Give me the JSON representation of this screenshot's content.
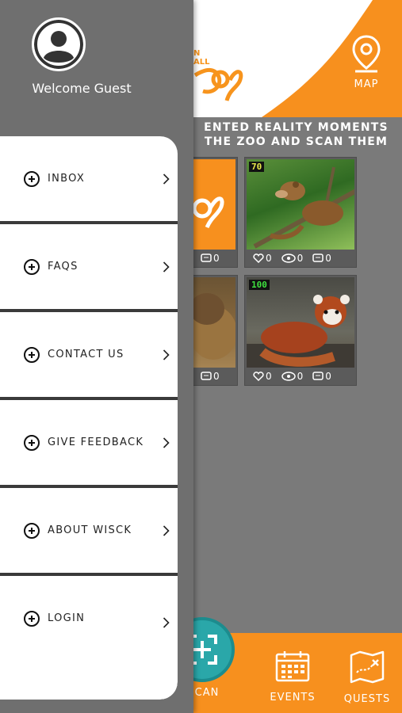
{
  "drawer": {
    "welcome": "Welcome Guest",
    "items": [
      {
        "label": "INBOX"
      },
      {
        "label": "FAQS"
      },
      {
        "label": "CONTACT US"
      },
      {
        "label": "GIVE FEEDBACK"
      },
      {
        "label": "ABOUT WISCK"
      },
      {
        "label": "LOGIN"
      }
    ]
  },
  "header": {
    "logo_text_line1": "N",
    "logo_text_line2": "ALL",
    "map_label": "MAP"
  },
  "banner": {
    "line1": "ENTED REALITY MOMENTS",
    "line2": "THE ZOO AND SCAN THEM"
  },
  "tiles": [
    {
      "score": "",
      "likes": "",
      "views": "",
      "comments": "0"
    },
    {
      "score": "70",
      "likes": "0",
      "views": "0",
      "comments": "0"
    },
    {
      "score": "",
      "likes": "",
      "views": "",
      "comments": "0"
    },
    {
      "score": "100",
      "likes": "0",
      "views": "0",
      "comments": "0"
    }
  ],
  "nav": {
    "scan": "CAN",
    "events": "EVENTS",
    "quests": "QUESTS"
  },
  "colors": {
    "accent": "#f7901e",
    "teal": "#2aa7a9",
    "drawer": "#6f6f6f",
    "score70": "#e8e84a",
    "score100": "#3fe03f"
  }
}
